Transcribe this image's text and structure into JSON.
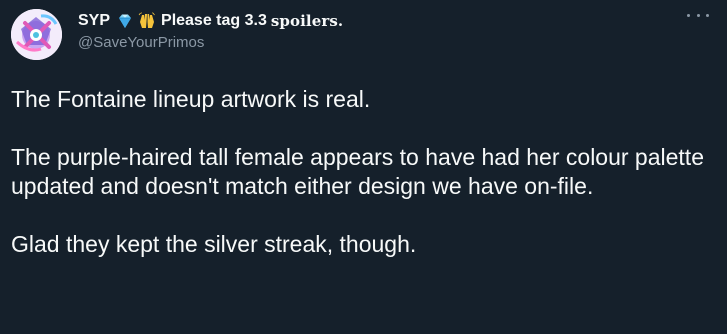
{
  "tweet": {
    "display_name": "SYP",
    "name_emoji_1": "gem-icon",
    "name_emoji_2": "raising-hands-icon",
    "name_suffix_1": "Please tag 3.3",
    "name_suffix_2": "spoilers.",
    "handle": "@SaveYourPrimos",
    "more_icon": "more-horizontal-icon",
    "paragraphs": [
      "The Fontaine lineup artwork is real.",
      "The purple-haired tall female appears to have had her colour palette updated and doesn't match either design we have on-file.",
      "Glad they kept the silver streak, though."
    ]
  },
  "colors": {
    "background": "#15202b",
    "text_primary": "#f7f9f9",
    "text_secondary": "#8b98a5"
  }
}
